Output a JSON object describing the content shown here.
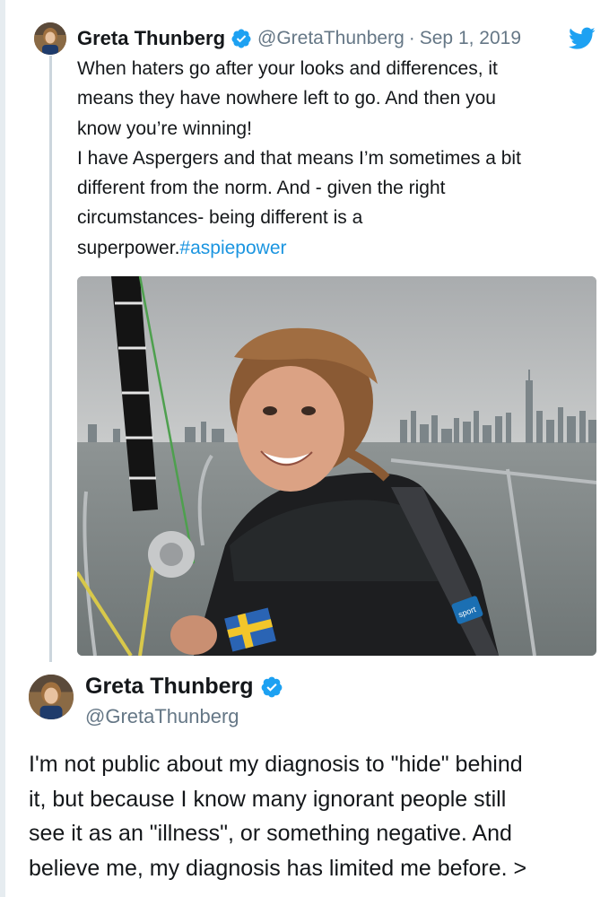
{
  "tweet": {
    "author_name": "Greta Thunberg",
    "handle": "@GretaThunberg",
    "separator": "·",
    "date": "Sep 1, 2019",
    "text_lines": [
      "When haters go after your looks and differences, it",
      "means they have nowhere left to go. And then you",
      "know you’re winning!",
      "I have Aspergers and that means I’m sometimes a bit",
      "different from the norm. And - given the right",
      "circumstances- being different is a"
    ],
    "last_line_prefix": "superpower.",
    "hashtag": "#aspiepower",
    "photo_patch_label": "sport"
  },
  "quoted": {
    "author_name": "Greta Thunberg",
    "handle": "@GretaThunberg",
    "text_lines": [
      "I'm not public about my diagnosis to \"hide\" behind",
      "it, but because I know many ignorant people still",
      "see it as an \"illness\", or something negative. And",
      "believe me, my diagnosis has limited me before. >"
    ]
  },
  "icons": {
    "verified": "verified-badge-icon",
    "twitter": "twitter-bird-icon"
  },
  "colors": {
    "accent": "#1da1f2",
    "hashtag": "#1b95e0",
    "secondary_text": "#657786",
    "primary_text": "#14171a",
    "thread_line": "#ccd6dd"
  }
}
